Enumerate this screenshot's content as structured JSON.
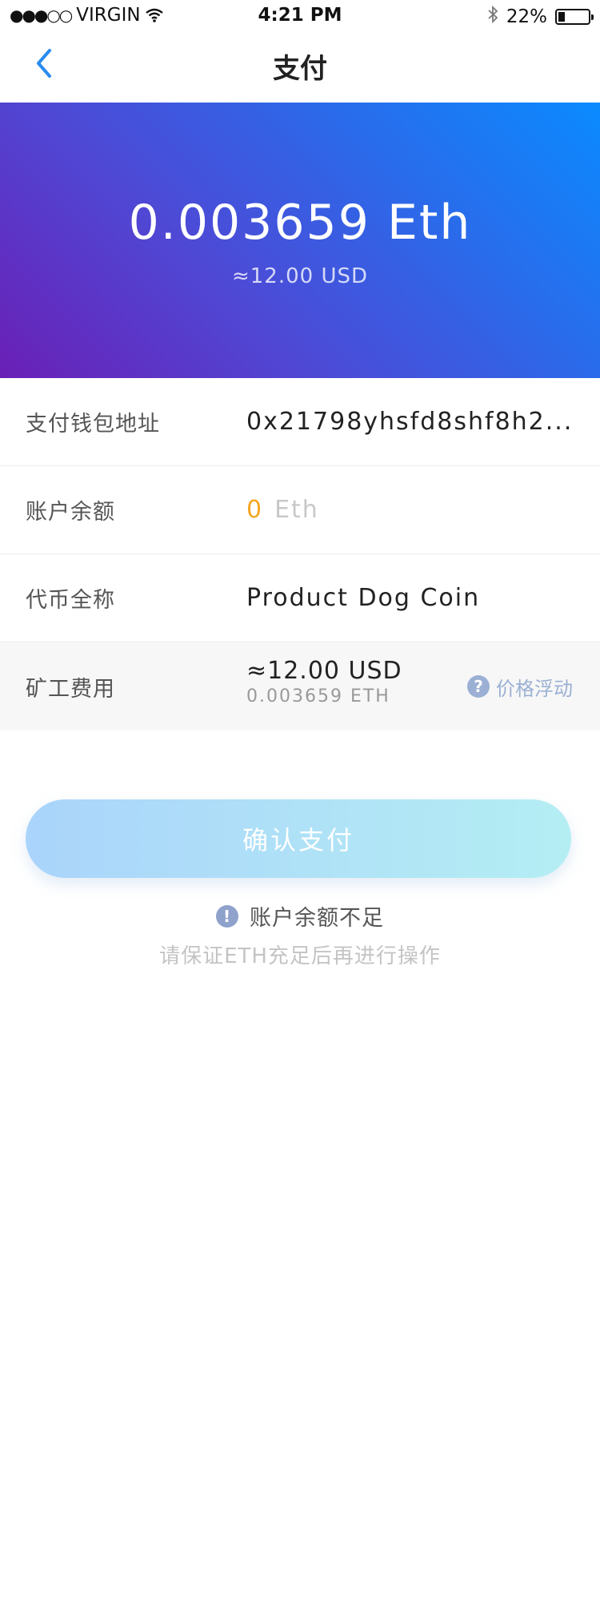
{
  "status_bar": {
    "carrier": "VIRGIN",
    "signal": "●●●○○",
    "time": "4:21 PM",
    "battery": "22%",
    "battery_level": 0.22,
    "icons": [
      "wifi-icon",
      "bluetooth-icon",
      "battery-icon"
    ]
  },
  "nav": {
    "title": "支付",
    "back_icon": "chevron-left-icon",
    "accent": "#2a8cf0"
  },
  "hero": {
    "amount": "0.003659 Eth",
    "usd": "≈12.00 USD"
  },
  "rows": {
    "address": {
      "label": "支付钱包地址",
      "value": "0x21798yhsfd8shf8h2..."
    },
    "balance": {
      "label": "账户余额",
      "amount": "0",
      "unit": "Eth"
    },
    "token": {
      "label": "代币全称",
      "value": "Product Dog Coin"
    },
    "fee": {
      "label": "矿工费用",
      "usd": "≈12.00 USD",
      "eth": "0.003659 ETH",
      "hint": "价格浮动",
      "hint_icon": "question-icon"
    }
  },
  "confirm": {
    "label": "确认支付"
  },
  "warning": {
    "icon": "exclamation-icon",
    "title": "账户余额不足",
    "subtitle": "请保证ETH充足后再进行操作"
  },
  "colors": {
    "balance_number": "#f5a623",
    "hint": "#9bb0d4",
    "hero_gradient": [
      "#0a8bff",
      "#6a1fb6"
    ]
  }
}
